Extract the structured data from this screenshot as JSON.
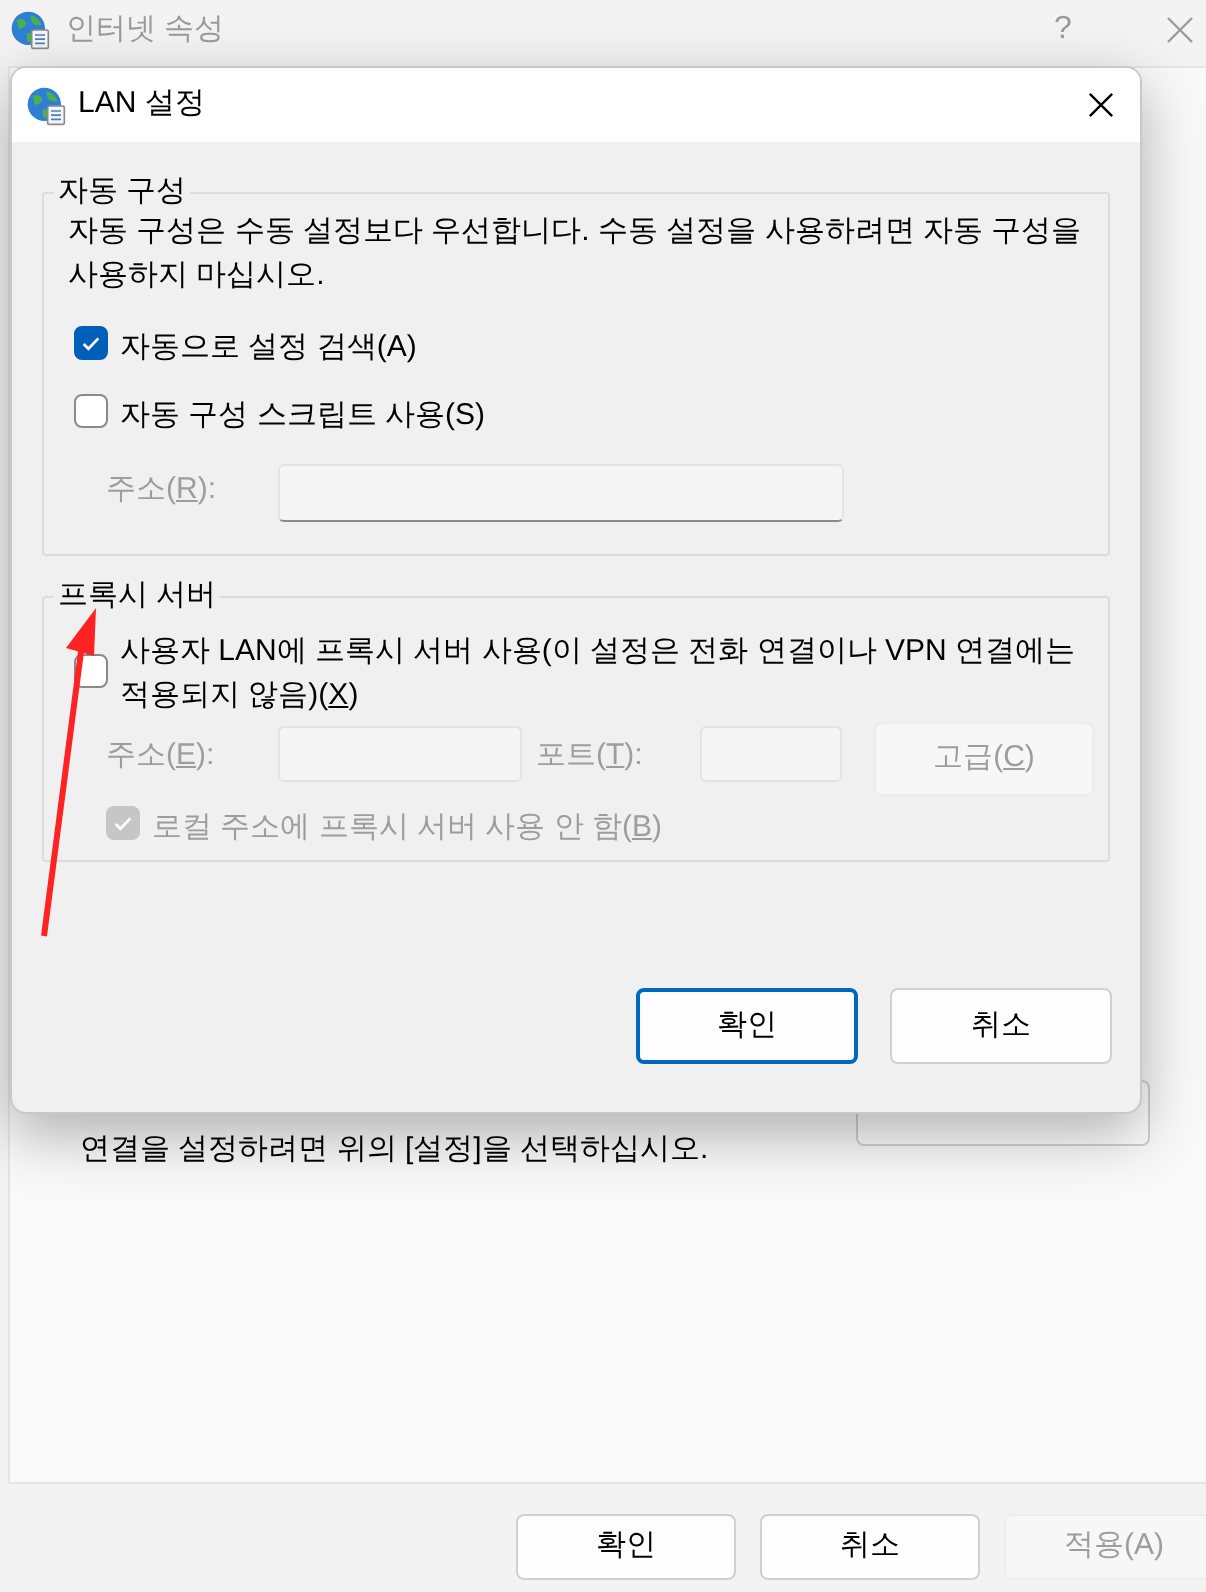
{
  "parent_window": {
    "title": "인터넷 속성",
    "active": false,
    "help": "?",
    "hint": "연결을 설정하려면 위의 [설정]을 선택하십시오.",
    "buttons": [
      {
        "label": "확인",
        "disabled": false
      },
      {
        "label": "취소",
        "disabled": false
      },
      {
        "label": "적용(A)",
        "disabled": true
      }
    ]
  },
  "dialog": {
    "title": "LAN 설정",
    "auto_config": {
      "legend": "자동 구성",
      "description": "자동 구성은 수동 설정보다 우선합니다. 수동 설정을 사용하려면 자동 구성을 사용하지 마십시오.",
      "options": [
        {
          "before": "자동으로 설정 검색(A)",
          "checked": true,
          "disabled": false
        },
        {
          "before": "자동 구성 스크립트 사용(S)",
          "checked": false,
          "disabled": false
        }
      ],
      "address": {
        "before": "주소(",
        "key": "R",
        "after": "):",
        "disabled": true
      }
    },
    "proxy": {
      "legend": "프록시 서버",
      "use_proxy": {
        "before": "사용자 LAN에 프록시 서버 사용(이 설정은 전화 연결이나 VPN 연결에는 적용되지 않음)(",
        "key": "X",
        "after": ")",
        "checked": false,
        "disabled": false
      },
      "address": {
        "before": "주소(",
        "key": "E",
        "after": "):",
        "disabled": true
      },
      "port": {
        "before": "포트(",
        "key": "T",
        "after": "):",
        "disabled": true
      },
      "advanced": {
        "before": "고급(",
        "key": "C",
        "after": ")",
        "disabled": true
      },
      "bypass_local": {
        "before": "로컬 주소에 프록시 서버 사용 안 함(",
        "key": "B",
        "after": ")",
        "checked": true,
        "disabled": true
      }
    },
    "buttons": [
      {
        "label": "확인",
        "default": true
      },
      {
        "label": "취소",
        "default": false
      }
    ]
  }
}
